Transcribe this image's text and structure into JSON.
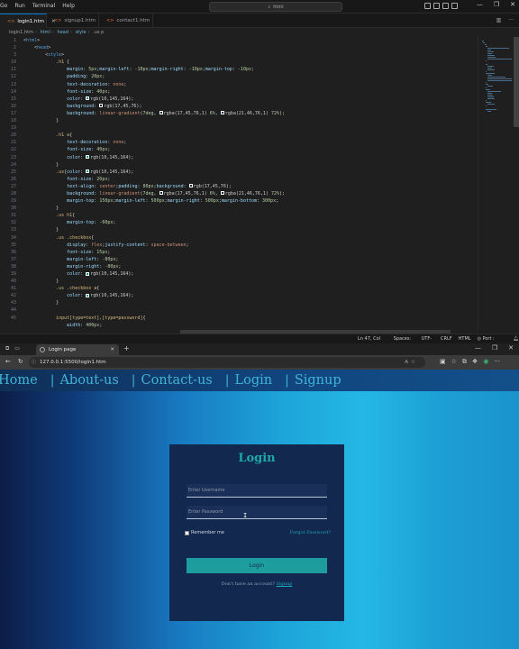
{
  "vscode": {
    "menu": [
      "Go",
      "Run",
      "Terminal",
      "Help"
    ],
    "search_text": "html",
    "window_controls": [
      "—",
      "❐",
      "✕"
    ],
    "tabs": [
      {
        "label": "login1.htm",
        "active": true
      },
      {
        "label": "signup1.htm",
        "active": false
      },
      {
        "label": "contact1.htm",
        "active": false
      }
    ],
    "breadcrumb": [
      "login1.htm",
      "html",
      "head",
      "style",
      ".us p"
    ],
    "line_numbers": [
      "1",
      "2",
      "3",
      "10",
      "11",
      "12",
      "13",
      "14",
      "15",
      "16",
      "17",
      "18",
      "19",
      "20",
      "21",
      "22",
      "23",
      "24",
      "25",
      "26",
      "27",
      "28",
      "29",
      "30",
      "31",
      "32",
      "33",
      "34",
      "35",
      "36",
      "37",
      "38",
      "39",
      "40",
      "41",
      "42",
      "43",
      "44",
      "45"
    ],
    "code_lines": [
      "<html>",
      "    <head>",
      "        <style>",
      "            .h1 {",
      "                margin: 5px;margin-left: -10px;margin-right: -10px;margin-top: -10px;",
      "                padding: 20px;",
      "                text-decoration: none;",
      "                font-size: 40px;",
      "                color: rgb(10,145,164);",
      "                background: rgb(17,45,76);",
      "                background: linear-gradient(7deg, rgba(17,45,76,1) 6%, rgba(21,46,76,1) 72%);",
      "            }",
      "",
      "            .h1 a{",
      "                text-decoration: none;",
      "                font-size: 40px;",
      "                color: rgb(10,145,164);",
      "            }",
      "            .us{color: rgb(10,145,164);",
      "                font-size: 20px;",
      "                text-align: center;padding: 80px;background: rgb(17,45,76);",
      "                background: linear-gradient(7deg, rgba(17,45,76,1) 6%, rgba(21,46,76,1) 72%);",
      "                margin-top: 150px;margin-left: 500px;margin-right: 500px;margin-bottom: 300px;",
      "            }",
      "            .us h1{",
      "                margin-top: -60px;",
      "            }",
      "            .us .checkbox{",
      "                display: flex;justify-content: space-between;",
      "                font-size: 15px;",
      "                margin-left: -80px;",
      "                margin-right: -80px;",
      "                color: rgb(10,145,164);",
      "            }",
      "            .us .checkbox a{",
      "                color: rgb(10,145,164);",
      "            }",
      "",
      "            input[type=text],[type=password]{",
      "                width: 400px;"
    ],
    "status_items": [
      "Ln 47, Col 19",
      "Spaces: 4",
      "UTF-8",
      "CRLF",
      "HTML",
      "Port : 5500"
    ],
    "swatch_colors": {
      "teal": "#0a91a4",
      "navy": "#112d4c",
      "navy2": "#152e4c"
    }
  },
  "browser": {
    "tab_title": "Login page",
    "url": "127.0.0.1:5500/login1.htm",
    "nav": [
      "Home",
      "About-us",
      "Contact-us",
      "Login",
      "Signup"
    ],
    "login": {
      "title": "Login",
      "username_placeholder": "Enter Username",
      "password_placeholder": "Enter Password",
      "remember_label": "Remember me",
      "forgot_label": "Forgot Password?",
      "button_label": "Login",
      "signup_prompt": "Don't have an account?",
      "signup_link": "Signup"
    },
    "colors": {
      "accent": "#1fa7a8",
      "box": "#13284f"
    }
  }
}
